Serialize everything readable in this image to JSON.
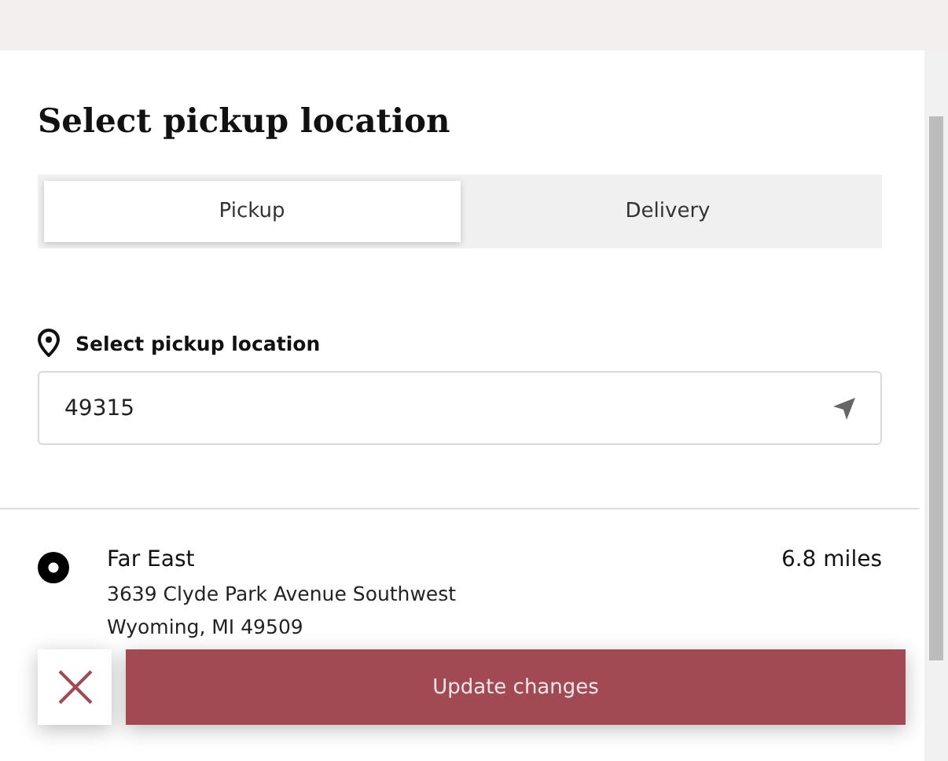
{
  "title": "Select pickup location",
  "tabs": [
    {
      "label": "Pickup",
      "selected": true
    },
    {
      "label": "Delivery",
      "selected": false
    }
  ],
  "location_label": "Select pickup location",
  "search": {
    "value": "49315"
  },
  "locations": [
    {
      "name": "Far East",
      "distance": "6.8 miles",
      "address": [
        "3639 Clyde Park Avenue Southwest",
        "Wyoming, MI 49509"
      ],
      "selected": true
    }
  ],
  "footer": {
    "button": "Update changes"
  }
}
